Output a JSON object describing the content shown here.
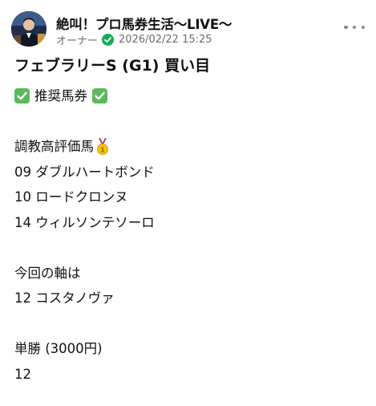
{
  "post": {
    "author": {
      "name": "絶叫！プロ馬券生活〜LIVE〜",
      "role": "オーナー",
      "timestamp": "2026/02/22 15:25"
    },
    "icons": {
      "verified": "verified-check-icon",
      "more": "more-options-icon",
      "checkmark": "checkmark-box-icon",
      "medal": "gold-medal-icon"
    },
    "title": "フェブラリーS (G1) 買い目",
    "recommend_label": "推奨馬券",
    "lines": {
      "eval_heading": "調教高評価馬",
      "horse1": "09 ダブルハートボンド",
      "horse2": "10 ロードクロンヌ",
      "horse3": "14 ウィルソンテソーロ",
      "axis_heading": "今回の軸は",
      "axis_horse": "12 コスタノヴァ",
      "bet_heading": "単勝 (3000円)",
      "bet_number": "12"
    },
    "colors": {
      "check_green": "#5cb85c",
      "verified_green": "#1aaa55",
      "meta_gray": "#6b6b6b"
    }
  }
}
